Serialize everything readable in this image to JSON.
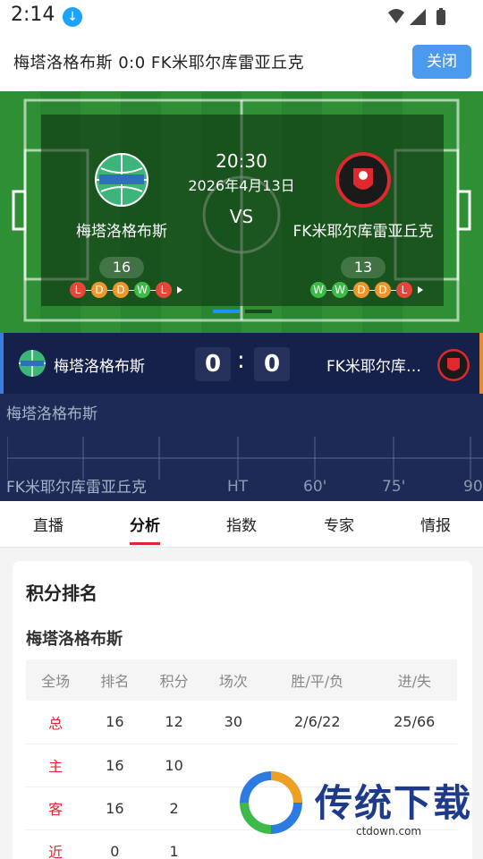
{
  "status": {
    "time": "2:14"
  },
  "header": {
    "title": "梅塔洛格布斯   0:0  FK米耶尔库雷亚丘克",
    "close_label": "关闭"
  },
  "match": {
    "time": "20:30",
    "date": "2026年4月13日",
    "vs": "VS",
    "home": {
      "name": "梅塔洛格布斯",
      "rank": "16",
      "form": [
        "L",
        "D",
        "D",
        "W",
        "L"
      ]
    },
    "away": {
      "name": "FK米耶尔库雷亚丘克",
      "rank": "13",
      "form": [
        "W",
        "W",
        "D",
        "D",
        "L"
      ]
    }
  },
  "scorebar": {
    "home_name": "梅塔洛格布斯",
    "home_score": "0",
    "colon": ":",
    "away_score": "0",
    "away_name": "FK米耶尔库雷亚丘克"
  },
  "timeline": {
    "home_label": "梅塔洛格布斯",
    "away_label": "FK米耶尔库雷亚丘克",
    "ticks": [
      "HT",
      "60'",
      "75'",
      "90"
    ]
  },
  "tabs": [
    {
      "label": "直播"
    },
    {
      "label": "分析"
    },
    {
      "label": "指数"
    },
    {
      "label": "专家"
    },
    {
      "label": "情报"
    }
  ],
  "standings": {
    "title": "积分排名",
    "team": "梅塔洛格布斯",
    "columns": [
      "全场",
      "排名",
      "积分",
      "场次",
      "胜/平/负",
      "进/失"
    ],
    "rows": [
      [
        "总",
        "16",
        "12",
        "30",
        "2/6/22",
        "25/66"
      ],
      [
        "主",
        "16",
        "10",
        "",
        "",
        ""
      ],
      [
        "客",
        "16",
        "2",
        "",
        "",
        ""
      ],
      [
        "近",
        "0",
        "1",
        "",
        "",
        ""
      ]
    ]
  },
  "watermark": {
    "text": "传统下载",
    "url": "ctdown.com"
  },
  "colors": {
    "accent_red": "#e3262e",
    "close_blue": "#4a9bf0",
    "navy": "#15214a",
    "pitch": "#2f8f34"
  }
}
